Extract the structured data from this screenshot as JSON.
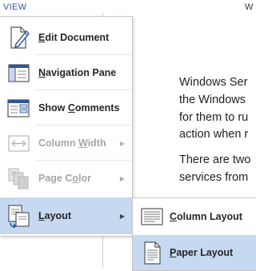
{
  "ribbon": {
    "tab_label": "VIEW",
    "right_glyph": "W"
  },
  "document": {
    "paragraphs": [
      {
        "lines": [
          "Windows Ser",
          "the Windows",
          "for them to ru",
          "action when r"
        ]
      },
      {
        "lines": [
          "There are two",
          "services from"
        ]
      }
    ]
  },
  "menu": {
    "items": [
      {
        "key": "edit_document",
        "mnemonic": "E",
        "rest": "dit Document",
        "icon": "edit-document-icon",
        "enabled": true,
        "has_submenu": false
      },
      {
        "key": "navigation_pane",
        "mnemonic": "N",
        "rest": "avigation Pane",
        "icon": "navigation-pane-icon",
        "enabled": true,
        "has_submenu": false
      },
      {
        "key": "show_comments",
        "pre": "Show ",
        "mnemonic": "C",
        "rest": "omments",
        "icon": "show-comments-icon",
        "enabled": true,
        "has_submenu": false
      },
      {
        "key": "column_width",
        "pre": "Column ",
        "mnemonic": "W",
        "rest": "idth",
        "icon": "column-width-icon",
        "enabled": false,
        "has_submenu": true
      },
      {
        "key": "page_color",
        "pre": "Page C",
        "mnemonic": "o",
        "rest": "lor",
        "icon": "page-color-icon",
        "enabled": false,
        "has_submenu": true
      },
      {
        "key": "layout",
        "mnemonic": "L",
        "rest": "ayout",
        "icon": "layout-icon",
        "enabled": true,
        "has_submenu": true,
        "selected": true
      }
    ],
    "submenu_arrow": "▶"
  },
  "submenu": {
    "items": [
      {
        "key": "column_layout",
        "mnemonic": "C",
        "rest": "olumn Layout",
        "icon": "column-layout-icon"
      },
      {
        "key": "paper_layout",
        "mnemonic": "P",
        "rest": "aper Layout",
        "icon": "paper-layout-icon",
        "selected": true
      }
    ]
  },
  "colors": {
    "accent": "#2b579a",
    "selection": "#c6d9f1",
    "disabled_text": "#a6a6a6"
  }
}
